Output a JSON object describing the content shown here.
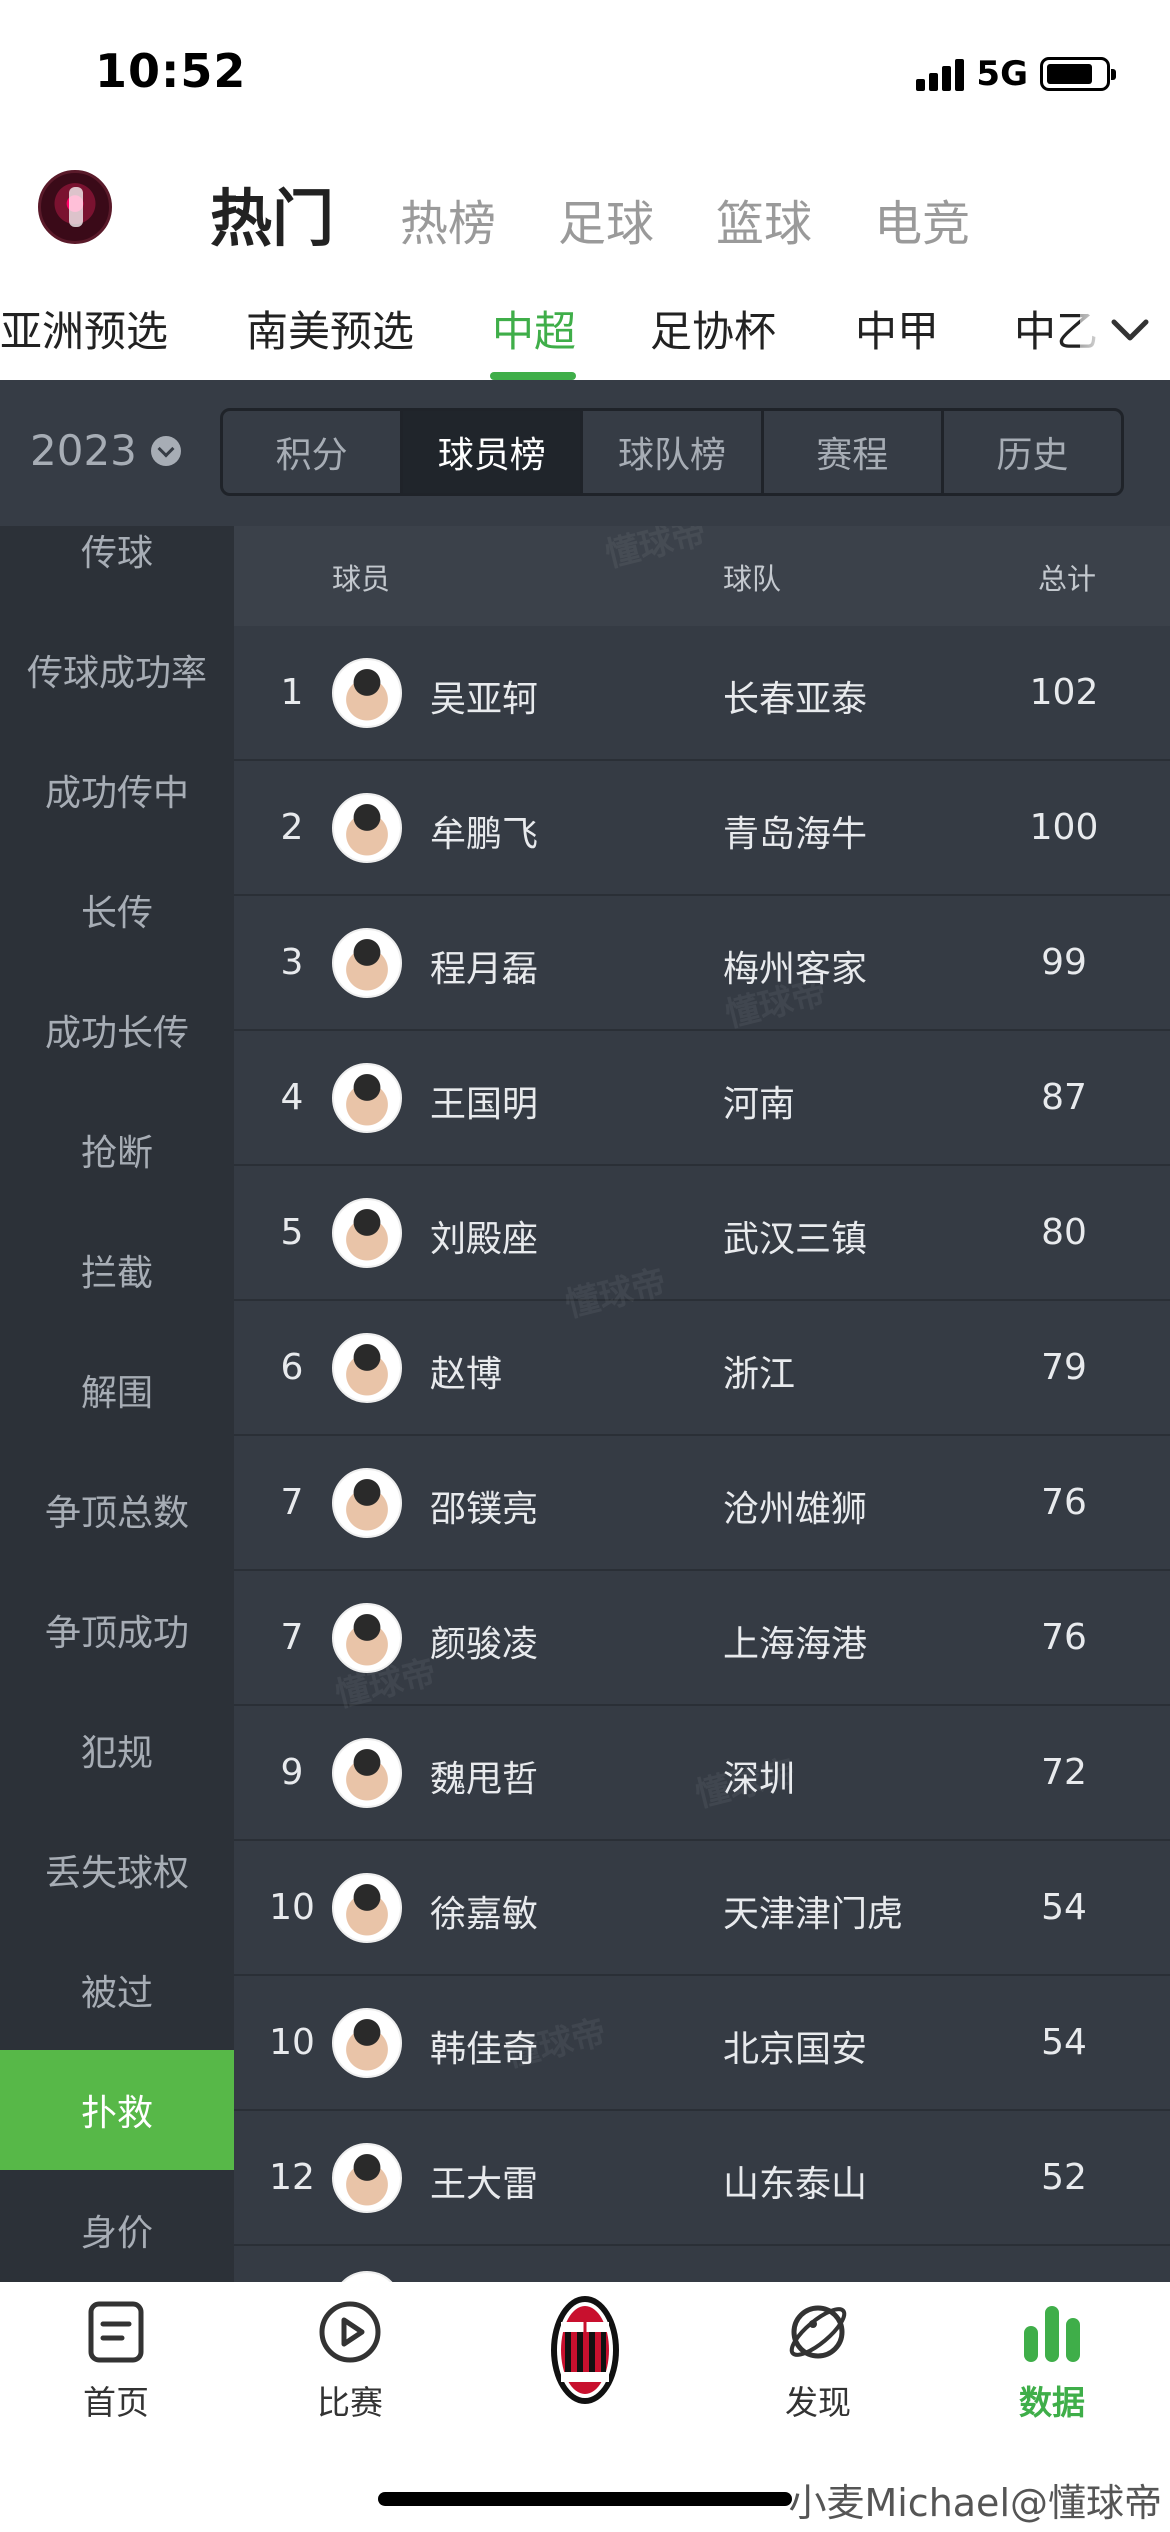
{
  "status_bar": {
    "time": "10:52",
    "network": "5G"
  },
  "top_nav": {
    "tabs": [
      {
        "label": "热门",
        "active": true
      },
      {
        "label": "热榜",
        "active": false
      },
      {
        "label": "足球",
        "active": false
      },
      {
        "label": "篮球",
        "active": false
      },
      {
        "label": "电竞",
        "active": false
      }
    ]
  },
  "leagues": [
    {
      "label": "亚洲预选",
      "active": false
    },
    {
      "label": "南美预选",
      "active": false
    },
    {
      "label": "中超",
      "active": true
    },
    {
      "label": "足协杯",
      "active": false
    },
    {
      "label": "中甲",
      "active": false
    },
    {
      "label": "中乙",
      "active": false
    }
  ],
  "filter": {
    "season": "2023",
    "segments": [
      {
        "label": "积分",
        "active": false
      },
      {
        "label": "球员榜",
        "active": true
      },
      {
        "label": "球队榜",
        "active": false
      },
      {
        "label": "赛程",
        "active": false
      },
      {
        "label": "历史",
        "active": false
      }
    ]
  },
  "sidebar": {
    "items": [
      {
        "label": "传球",
        "active": false
      },
      {
        "label": "传球成功率",
        "active": false
      },
      {
        "label": "成功传中",
        "active": false
      },
      {
        "label": "长传",
        "active": false
      },
      {
        "label": "成功长传",
        "active": false
      },
      {
        "label": "抢断",
        "active": false
      },
      {
        "label": "拦截",
        "active": false
      },
      {
        "label": "解围",
        "active": false
      },
      {
        "label": "争顶总数",
        "active": false
      },
      {
        "label": "争顶成功",
        "active": false
      },
      {
        "label": "犯规",
        "active": false
      },
      {
        "label": "丢失球权",
        "active": false
      },
      {
        "label": "被过",
        "active": false
      },
      {
        "label": "扑救",
        "active": true
      },
      {
        "label": "身价",
        "active": false
      }
    ]
  },
  "table": {
    "headers": {
      "player": "球员",
      "team": "球队",
      "total": "总计"
    },
    "rows": [
      {
        "rank": "1",
        "player": "吴亚轲",
        "team": "长春亚泰",
        "total": "102"
      },
      {
        "rank": "2",
        "player": "牟鹏飞",
        "team": "青岛海牛",
        "total": "100"
      },
      {
        "rank": "3",
        "player": "程月磊",
        "team": "梅州客家",
        "total": "99"
      },
      {
        "rank": "4",
        "player": "王国明",
        "team": "河南",
        "total": "87"
      },
      {
        "rank": "5",
        "player": "刘殿座",
        "team": "武汉三镇",
        "total": "80"
      },
      {
        "rank": "6",
        "player": "赵博",
        "team": "浙江",
        "total": "79"
      },
      {
        "rank": "7",
        "player": "邵镤亮",
        "team": "沧州雄狮",
        "total": "76"
      },
      {
        "rank": "7",
        "player": "颜骏凌",
        "team": "上海海港",
        "total": "76"
      },
      {
        "rank": "9",
        "player": "魏甩哲",
        "team": "深圳",
        "total": "72"
      },
      {
        "rank": "10",
        "player": "徐嘉敏",
        "team": "天津津门虎",
        "total": "54"
      },
      {
        "rank": "10",
        "player": "韩佳奇",
        "team": "北京国安",
        "total": "54"
      },
      {
        "rank": "12",
        "player": "王大雷",
        "team": "山东泰山",
        "total": "52"
      }
    ]
  },
  "watermark": "懂球帝",
  "tabbar": {
    "items": [
      {
        "label": "首页",
        "icon": "document-icon",
        "active": false
      },
      {
        "label": "比赛",
        "icon": "play-icon",
        "active": false
      },
      {
        "label": "",
        "icon": "ac-milan-logo",
        "active": false
      },
      {
        "label": "发现",
        "icon": "planet-icon",
        "active": false
      },
      {
        "label": "数据",
        "icon": "bar-chart-icon",
        "active": true
      }
    ]
  },
  "credit": "小麦Michael@懂球帝",
  "colors": {
    "accent": "#3fae49",
    "dark_bg": "#272c33",
    "sidebar_active": "#57b848"
  }
}
